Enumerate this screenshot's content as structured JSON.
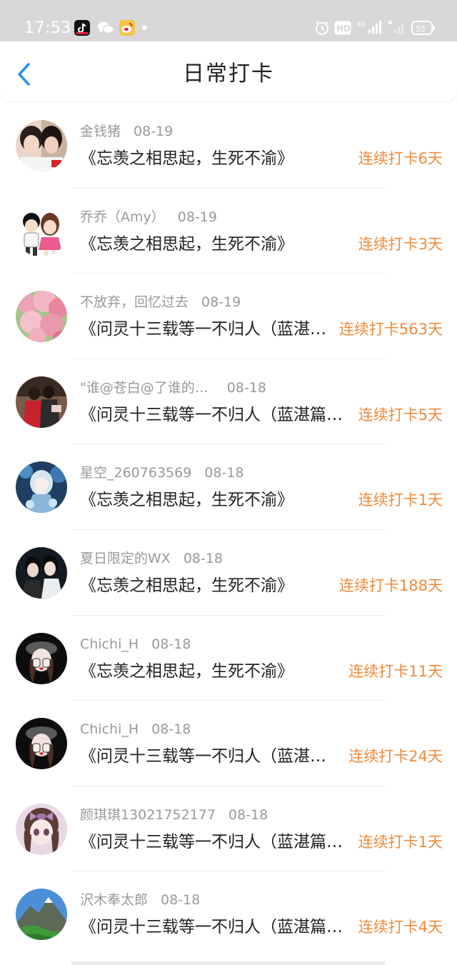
{
  "status_bar": {
    "time": "17:53",
    "battery": "55",
    "hd_label": "HD",
    "network": "4G"
  },
  "header": {
    "title": "日常打卡"
  },
  "checkins": [
    {
      "name": "金钱猪",
      "date": "08-19",
      "title": "《忘羡之相思起，生死不渝》",
      "streak": "连续打卡6天",
      "avatar": "avatar-photo-two-girls"
    },
    {
      "name": "乔乔（Amy）",
      "date": "08-19",
      "title": "《忘羡之相思起，生死不渝》",
      "streak": "连续打卡3天",
      "avatar": "avatar-cartoon-couple"
    },
    {
      "name": "不放弃，回忆过去",
      "date": "08-19",
      "title": "《问灵十三载等一不归人（蓝湛…",
      "streak": "连续打卡563天",
      "avatar": "avatar-pink-blossoms"
    },
    {
      "name": "\"谁@苍白@了谁的…",
      "date": "08-18",
      "title": "《问灵十三载等一不归人（蓝湛篇…",
      "streak": "连续打卡5天",
      "avatar": "avatar-couple-red"
    },
    {
      "name": "星空_260763569",
      "date": "08-18",
      "title": "《忘羡之相思起，生死不渝》",
      "streak": "连续打卡1天",
      "avatar": "avatar-anime-blue"
    },
    {
      "name": "夏日限定的WX",
      "date": "08-18",
      "title": "《忘羡之相思起，生死不渝》",
      "streak": "连续打卡188天",
      "avatar": "avatar-two-men"
    },
    {
      "name": "Chichi_H",
      "date": "08-18",
      "title": "《忘羡之相思起，生死不渝》",
      "streak": "连续打卡11天",
      "avatar": "avatar-cartoon-girl-hat"
    },
    {
      "name": "Chichi_H",
      "date": "08-18",
      "title": "《问灵十三载等一不归人（蓝湛…",
      "streak": "连续打卡24天",
      "avatar": "avatar-cartoon-girl-hat"
    },
    {
      "name": "颜琪琪13021752177",
      "date": "08-18",
      "title": "《问灵十三载等一不归人（蓝湛篇…",
      "streak": "连续打卡1天",
      "avatar": "avatar-anime-girl-bow"
    },
    {
      "name": "沢木奉太郎",
      "date": "08-18",
      "title": "《问灵十三载等一不归人（蓝湛篇…",
      "streak": "连续打卡4天",
      "avatar": "avatar-mountain-landscape"
    }
  ],
  "colors": {
    "accent_back": "#2a8ff0",
    "streak": "#f08a3c",
    "status_bar_bg": "#d8d8d8"
  }
}
